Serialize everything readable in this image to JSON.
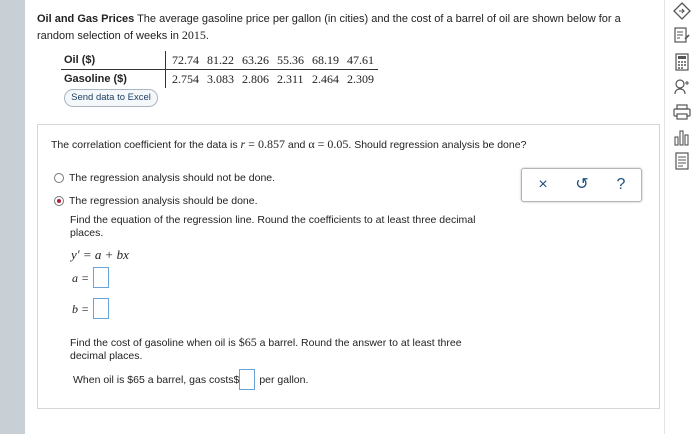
{
  "problem": {
    "title": "Oil and Gas Prices",
    "intro_text": "The average gasoline price per gallon (in cities) and the cost of a barrel of oil are shown below for a random selection of weeks in",
    "year": "2015",
    "period": "."
  },
  "table": {
    "rows": [
      {
        "label": "Oil ($)",
        "values": [
          "72.74",
          "81.22",
          "63.26",
          "55.36",
          "68.19",
          "47.61"
        ]
      },
      {
        "label": "Gasoline ($)",
        "values": [
          "2.754",
          "3.083",
          "2.806",
          "2.311",
          "2.464",
          "2.309"
        ]
      }
    ]
  },
  "send_button": "Send data to Excel",
  "question": {
    "prefix": "The correlation coefficient for the data is",
    "r_var": "r",
    "r_eq": " = 0.857",
    "mid": " and",
    "alpha": "α = 0.05",
    "suffix": ". Should regression analysis be done?"
  },
  "options": [
    {
      "label": "The regression analysis should not be done.",
      "selected": false
    },
    {
      "label": "The regression analysis should be done.",
      "selected": true
    }
  ],
  "tools": {
    "close": "×",
    "undo": "↺",
    "help": "?"
  },
  "find_equation": "Find the equation of the regression line. Round the coefficients to at least three decimal places.",
  "equation": "y′ = a + bx",
  "coef_a": "a =",
  "coef_b": "b =",
  "find_cost": {
    "prefix": "Find the cost of gasoline when oil is",
    "amount": "$65",
    "suffix": "a barrel. Round the answer to at least three decimal places."
  },
  "answer_row": {
    "prefix": "When oil is $65 a barrel, gas costs$",
    "suffix": "per gallon."
  },
  "icons": [
    "diamond-icon",
    "edit-icon",
    "calculator-icon",
    "hint-icon",
    "print-icon",
    "chart-icon",
    "document-icon"
  ]
}
